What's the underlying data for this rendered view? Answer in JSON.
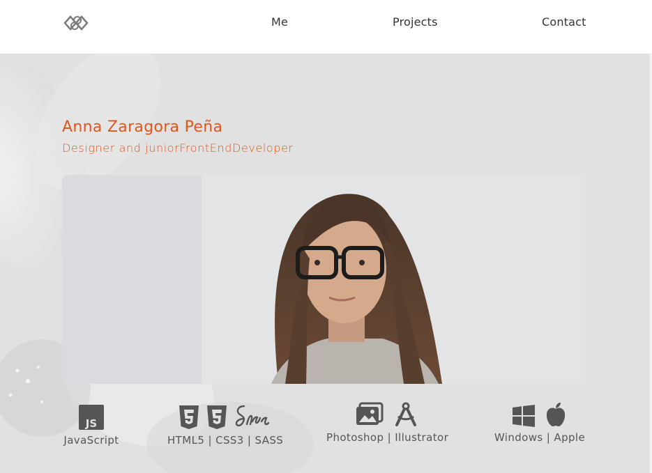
{
  "header": {
    "logo_icon": "infinity-logo-icon",
    "nav": [
      {
        "label": "Me"
      },
      {
        "label": "Projects"
      },
      {
        "label": "Contact"
      }
    ]
  },
  "hero": {
    "name": "Anna Zaragora Peña",
    "tagline": "Designer and juniorFrontEndDeveloper",
    "accent_color": "#e0561d"
  },
  "skills": [
    {
      "label": "JavaScript",
      "icons": [
        "javascript-icon"
      ]
    },
    {
      "label": "HTML5 | CSS3 | SASS",
      "icons": [
        "html5-icon",
        "css3-icon",
        "sass-icon"
      ]
    },
    {
      "label": "Photoshop | Illustrator",
      "icons": [
        "photoshop-icon",
        "illustrator-icon"
      ]
    },
    {
      "label": "Windows | Apple",
      "icons": [
        "windows-icon",
        "apple-icon"
      ]
    }
  ]
}
